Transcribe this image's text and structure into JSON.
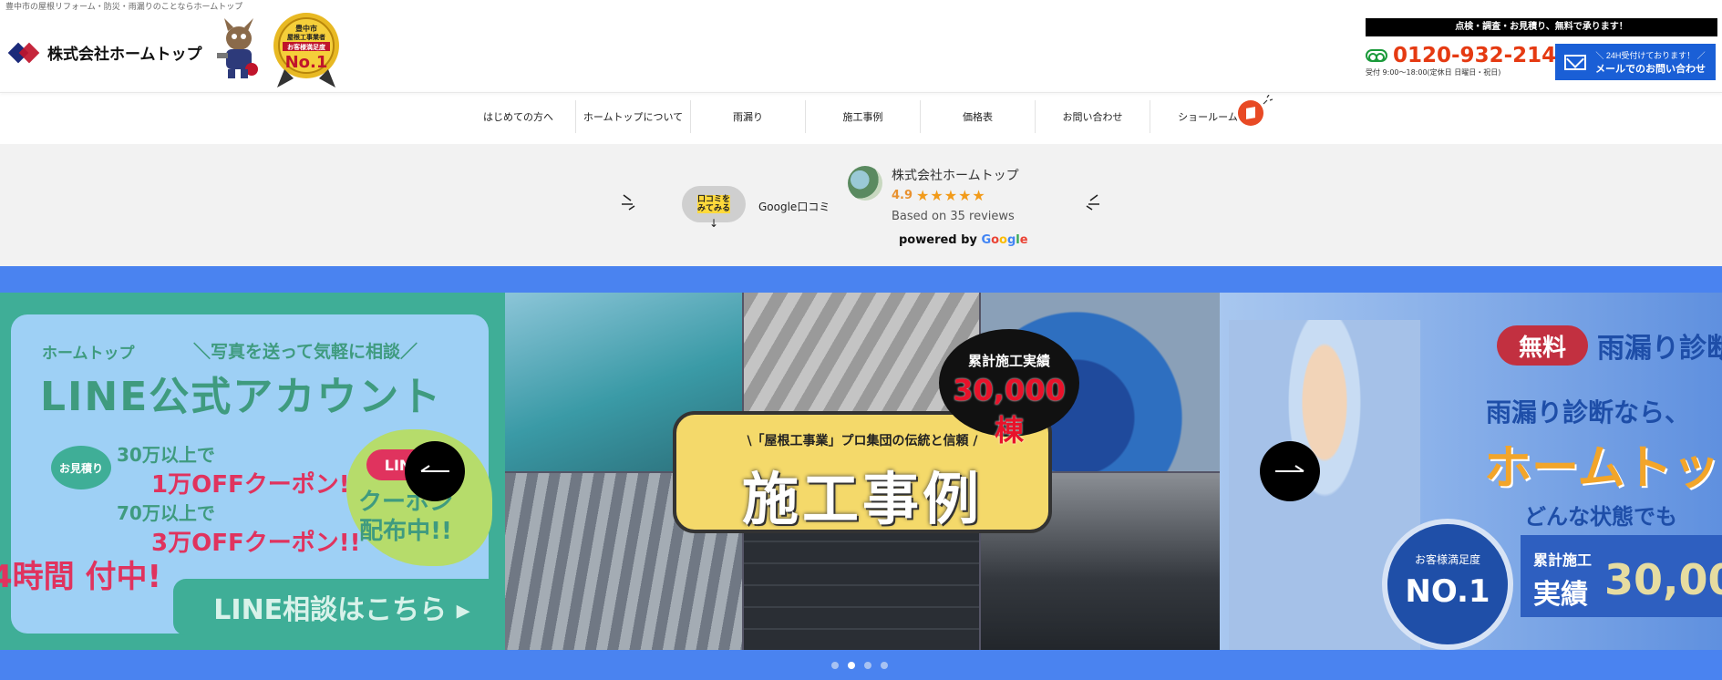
{
  "header": {
    "tagline": "豊中市の屋根リフォーム・防災・雨漏りのことならホームトップ",
    "logo_text": "株式会社ホームトップ",
    "badge": {
      "line1": "豊中市",
      "line2": "屋根工事業者",
      "line3": "お客様満足度",
      "line4": "No.1"
    },
    "cta_strip": "点検・調査・お見積り、無料で承ります！",
    "phone_number": "0120-932-214",
    "hours": "受付 9:00〜18:00(定休日 日曜日・祝日)",
    "mail_line1": "＼ 24H受付けております！ ／",
    "mail_line2": "メールでのお問い合わせ"
  },
  "nav": {
    "items": [
      {
        "label": "はじめての方へ"
      },
      {
        "label": "ホームトップについて"
      },
      {
        "label": "雨漏り"
      },
      {
        "label": "施工事例"
      },
      {
        "label": "価格表"
      },
      {
        "label": "お問い合わせ"
      },
      {
        "label": "ショールーム"
      }
    ]
  },
  "reviews": {
    "bubble_line1": "口コミを",
    "bubble_line2": "みてみる",
    "google_label": "Google口コミ",
    "business_name": "株式会社ホームトップ",
    "rating": "4.9",
    "stars": "★★★★★",
    "based_on": "Based on 35 reviews",
    "powered_prefix": "powered by ",
    "google_letters": [
      "G",
      "o",
      "o",
      "g",
      "l",
      "e"
    ]
  },
  "slider": {
    "line_slide": {
      "brand": "ホームトップ",
      "subtitle": "＼写真を送って気軽に相談／",
      "title": "LINE公式アカウント",
      "quote_label": "お見積り",
      "coupon1_cond": "30万以上で",
      "coupon1_value": "1万OFFクーポン!!",
      "coupon2_cond": "70万以上で",
      "coupon2_value": "3万OFFクーポン!!",
      "limited_label": "LINE",
      "distribution": "クーポン配布中!!",
      "hours_24": "4時間 付中!",
      "cta": "LINE相談はこちら ▸"
    },
    "cases_slide": {
      "sub": "\\「屋根工事業」プロ集団の伝統と信頼 /",
      "title": "施工事例",
      "bubble_line1": "累計施工実績",
      "bubble_line2": "30,000棟"
    },
    "leak_slide": {
      "free": "無料",
      "title": "雨漏り診断",
      "line1": "雨漏り診断なら、",
      "line2": "ホームトッ",
      "line3": "どんな状態でも",
      "medal_top": "お客様満足度",
      "medal_num": "NO.1",
      "record_a": "累計施工",
      "record_b": "実績",
      "record_c": "30,00"
    },
    "active_index": 1,
    "dot_count": 4
  },
  "colors": {
    "accent_phone": "#e53a12",
    "slider_bg": "#4a83f0",
    "mail_button": "#1a5fd6",
    "star": "#f29b1a"
  }
}
